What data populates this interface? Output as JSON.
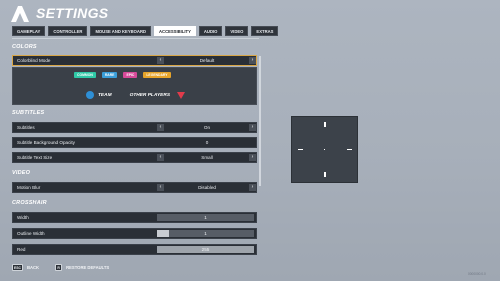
{
  "header": {
    "title": "SETTINGS"
  },
  "tabs": [
    {
      "label": "GAMEPLAY",
      "active": false
    },
    {
      "label": "CONTROLLER",
      "active": false
    },
    {
      "label": "MOUSE AND KEYBOARD",
      "active": false
    },
    {
      "label": "ACCESSIBILITY",
      "active": true
    },
    {
      "label": "AUDIO",
      "active": false
    },
    {
      "label": "VIDEO",
      "active": false
    },
    {
      "label": "EXTRAS",
      "active": false
    }
  ],
  "sections": {
    "colors": "COLORS",
    "subtitles": "SUBTITLES",
    "video": "VIDEO",
    "crosshair": "CROSSHAIR"
  },
  "colors": {
    "colorblind_mode": {
      "label": "Colorblind Mode",
      "value": "Default"
    },
    "chips": [
      {
        "label": "COMMON",
        "color": "#2fc9a7"
      },
      {
        "label": "RARE",
        "color": "#3a9ed9"
      },
      {
        "label": "EPIC",
        "color": "#d84a9a"
      },
      {
        "label": "LEGENDARY",
        "color": "#e6a42a"
      }
    ],
    "legend": {
      "team": "TEAM",
      "other_players": "OTHER PLAYERS",
      "team_color": "#2e8fd6",
      "enemy_color": "#e23b4b"
    }
  },
  "subtitles": {
    "subtitles": {
      "label": "Subtitles",
      "value": "On"
    },
    "background_opacity": {
      "label": "Subtitle Background Opacity",
      "value": "0"
    },
    "text_size": {
      "label": "Subtitle Text Size",
      "value": "Small"
    }
  },
  "video": {
    "motion_blur": {
      "label": "Motion Blur",
      "value": "Disabled"
    }
  },
  "crosshair": {
    "width": {
      "label": "Width",
      "value": "1",
      "fill": 0.0
    },
    "outline_width": {
      "label": "Outline Width",
      "value": "1",
      "fill": 0.12
    },
    "red": {
      "label": "Red",
      "value": "255",
      "fill": 1.0
    }
  },
  "footer": {
    "back_key": "ESC",
    "back_label": "BACK",
    "restore_key": "R",
    "restore_label": "RESTORE DEFAULTS"
  },
  "build": "0000000.0.0",
  "icons": {
    "arrow_left": "‹",
    "arrow_right": "›"
  }
}
